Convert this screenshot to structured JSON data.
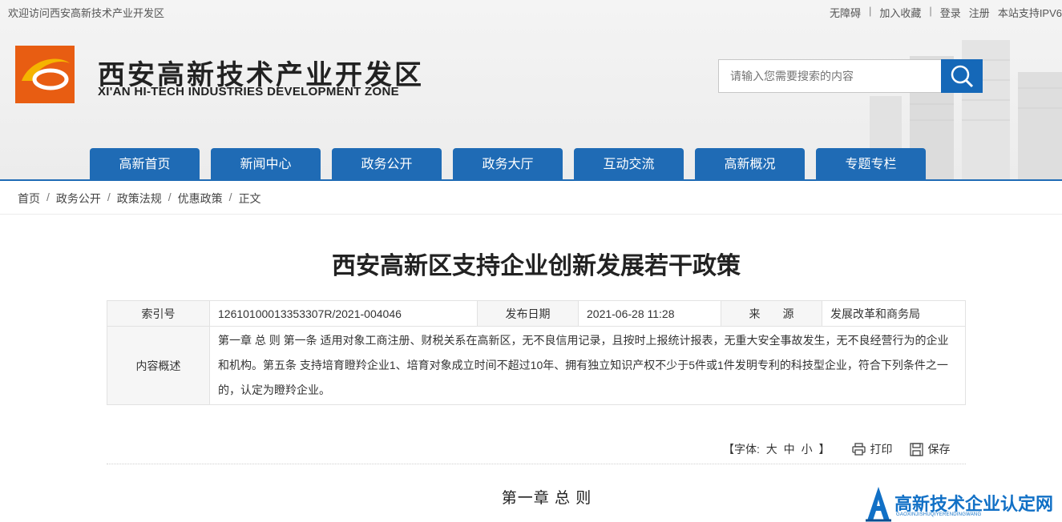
{
  "topbar": {
    "welcome": "欢迎访问西安高新技术产业开发区",
    "links": [
      "无障碍",
      "加入收藏",
      "登录",
      "注册",
      "本站支持IPV6"
    ]
  },
  "logo": {
    "cn": "西安高新技术产业开发区",
    "en": "XI'AN HI-TECH INDUSTRIES DEVELOPMENT ZONE"
  },
  "search": {
    "placeholder": "请输入您需要搜索的内容"
  },
  "nav": [
    "高新首页",
    "新闻中心",
    "政务公开",
    "政务大厅",
    "互动交流",
    "高新概况",
    "专题专栏"
  ],
  "breadcrumb": [
    "首页",
    "政务公开",
    "政策法规",
    "优惠政策",
    "正文"
  ],
  "breadcrumb_sep": "/",
  "article": {
    "title": "西安高新区支持企业创新发展若干政策",
    "index_label": "索引号",
    "index_value": "12610100013353307R/2021-004046",
    "date_label": "发布日期",
    "date_value": "2021-06-28 11:28",
    "source_label": "来　　源",
    "source_value": "发展改革和商务局",
    "summary_label": "内容概述",
    "summary_value": "第一章 总 则 第一条 适用对象工商注册、财税关系在高新区，无不良信用记录，且按时上报统计报表，无重大安全事故发生，无不良经营行为的企业和机构。第五条 支持培育瞪羚企业1、培育对象成立时间不超过10年、拥有独立知识产权不少于5件或1件发明专利的科技型企业，符合下列条件之一的，认定为瞪羚企业。",
    "chapter": "第一章 总 则"
  },
  "tools": {
    "font_prefix": "【字体:",
    "font_large": "大",
    "font_medium": "中",
    "font_small": "小",
    "font_suffix": "】",
    "print": "打印",
    "save": "保存"
  },
  "badge": {
    "title": "高新技术企业认定网",
    "subtitle": "GAOXINJISHUQIYERENDINGWANG"
  },
  "colors": {
    "brand_blue": "#1f6bb5",
    "logo_orange": "#e85d12",
    "logo_yellow": "#f5b400"
  }
}
